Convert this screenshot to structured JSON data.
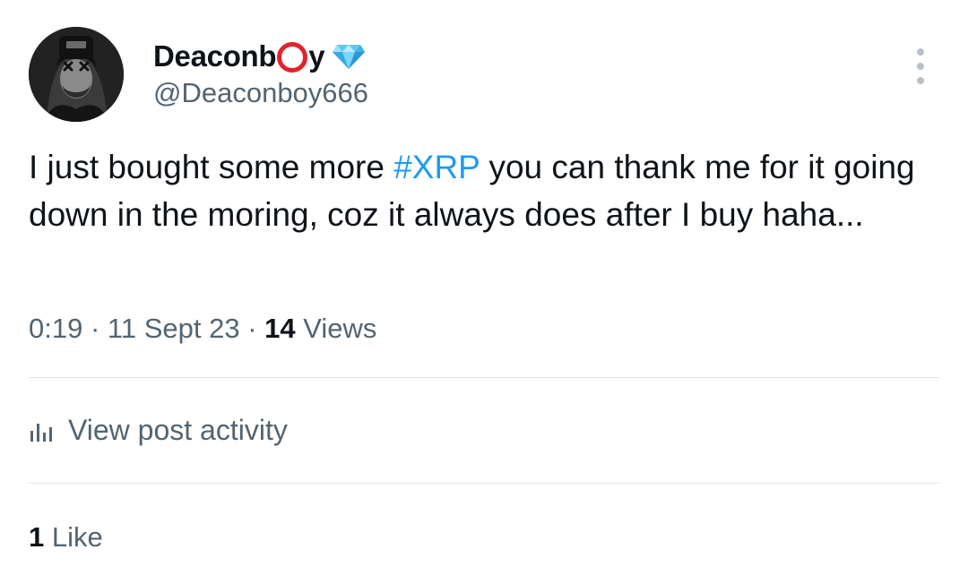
{
  "author": {
    "name_before": "Deaconb",
    "name_after": "y",
    "handle": "@Deaconboy666",
    "avatar_icon": "avatar-photo",
    "badge_icon": "diamond-icon"
  },
  "tweet": {
    "text_before": "I just bought some more ",
    "hashtag": "#XRP",
    "text_after": " you can thank me for it going down in the moring, coz it always does after I buy haha..."
  },
  "meta": {
    "time": "0:19",
    "sep1": " · ",
    "date": "11 Sept 23",
    "sep2": " · ",
    "views_count": "14",
    "views_label": " Views"
  },
  "actions": {
    "activity_label": "View post activity",
    "activity_icon": "bar-chart-icon",
    "more_icon": "more-vertical-icon"
  },
  "likes": {
    "count": "1",
    "label": " Like"
  },
  "colors": {
    "hashtag": "#1d9bf0",
    "secondary_text": "#536471",
    "ring": "#e0242b",
    "diamond": "#5ec8f2"
  }
}
